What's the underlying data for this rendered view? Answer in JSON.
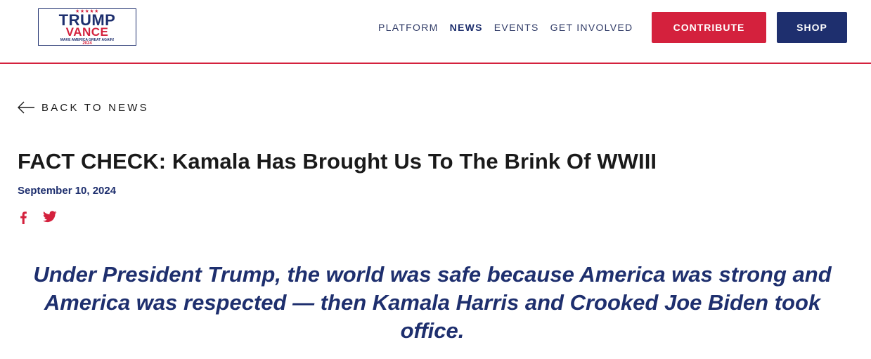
{
  "logo": {
    "stars": "★★★★★",
    "line1": "TRUMP",
    "line2": "VANCE",
    "tagline": "MAKE AMERICA GREAT AGAIN!",
    "year": "2024"
  },
  "nav": {
    "items": [
      {
        "label": "PLATFORM",
        "active": false
      },
      {
        "label": "NEWS",
        "active": true
      },
      {
        "label": "EVENTS",
        "active": false
      },
      {
        "label": "GET INVOLVED",
        "active": false
      }
    ]
  },
  "buttons": {
    "contribute": "CONTRIBUTE",
    "shop": "SHOP"
  },
  "back_link": "BACK TO NEWS",
  "article": {
    "title": "FACT CHECK: Kamala Has Brought Us To The Brink Of WWIII",
    "date": "September 10, 2024",
    "quote": "Under President Trump, the world was safe because America was strong and America was respected — then Kamala Harris and Crooked Joe Biden took office."
  },
  "social": {
    "icons": [
      "facebook-icon",
      "twitter-icon"
    ]
  },
  "colors": {
    "red": "#d4213d",
    "navy": "#1e2f6e"
  }
}
